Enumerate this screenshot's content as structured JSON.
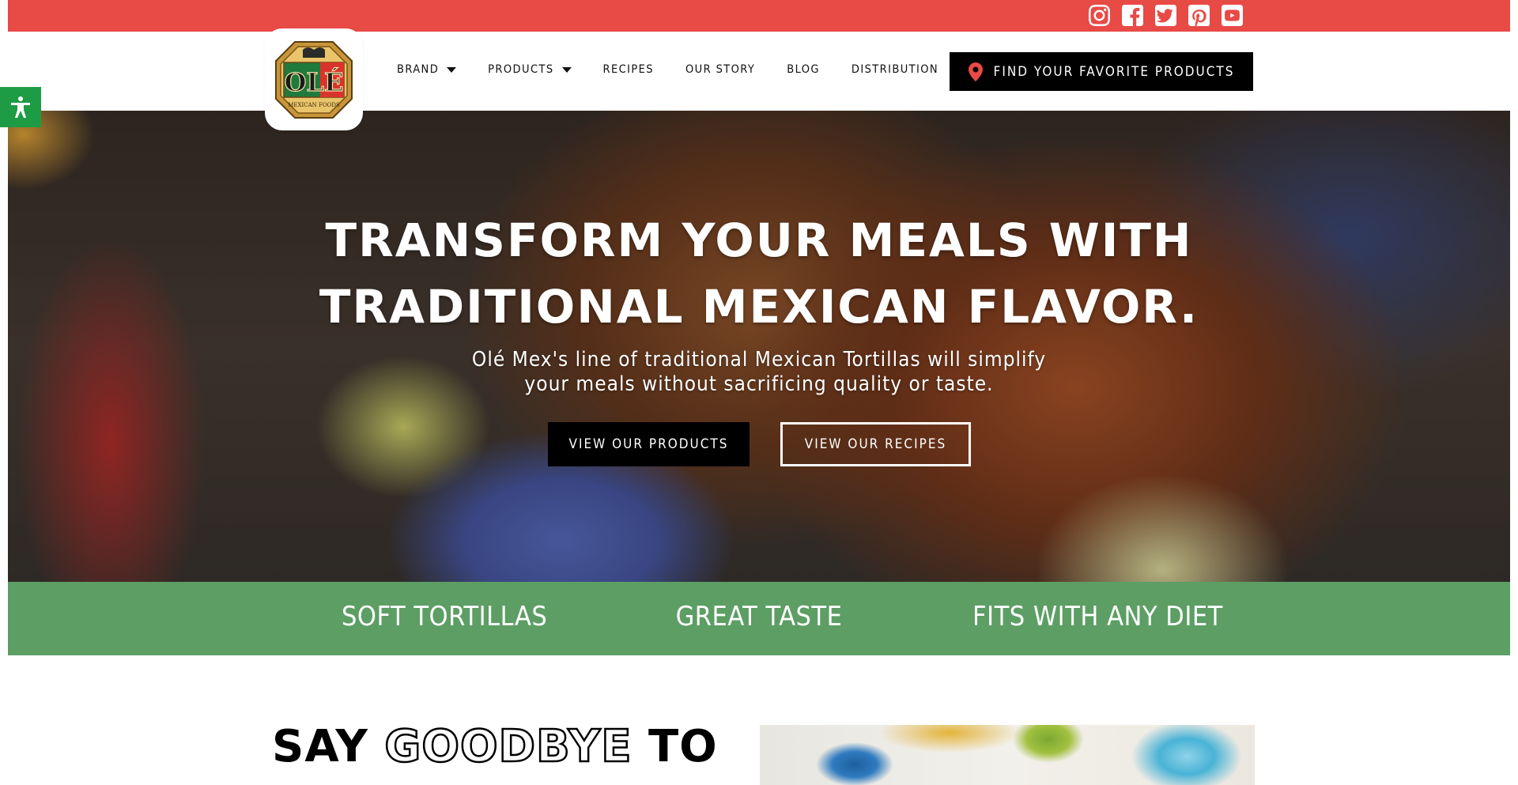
{
  "social": {
    "icons": [
      "instagram-icon",
      "facebook-icon",
      "twitter-icon",
      "pinterest-icon",
      "youtube-icon"
    ]
  },
  "logo": {
    "brand": "OLÉ",
    "tagline": "MEXICAN FOODS"
  },
  "nav": {
    "items": [
      {
        "label": "BRAND",
        "dropdown": true
      },
      {
        "label": "PRODUCTS",
        "dropdown": true
      },
      {
        "label": "RECIPES",
        "dropdown": false
      },
      {
        "label": "OUR STORY",
        "dropdown": false
      },
      {
        "label": "BLOG",
        "dropdown": false
      },
      {
        "label": "DISTRIBUTION",
        "dropdown": false
      }
    ],
    "find_button": "FIND YOUR FAVORITE PRODUCTS"
  },
  "hero": {
    "title_line1": "TRANSFORM YOUR MEALS WITH",
    "title_line2": "TRADITIONAL MEXICAN FLAVOR.",
    "subtitle_line1": "Olé Mex's line of traditional Mexican Tortillas will simplify",
    "subtitle_line2": "your meals without sacrificing quality or taste.",
    "primary_button": "VIEW OUR PRODUCTS",
    "secondary_button": "VIEW OUR RECIPES"
  },
  "features": [
    "SOFT TORTILLAS",
    "GREAT TASTE",
    "FITS WITH ANY DIET"
  ],
  "section": {
    "heading_word1": "SAY",
    "heading_word2": "GOODBYE",
    "heading_word3": "TO"
  },
  "colors": {
    "topbar": "#e84a46",
    "feature_band": "#5c9e64",
    "accessibility": "#1e9c45",
    "pin": "#e84a46"
  }
}
